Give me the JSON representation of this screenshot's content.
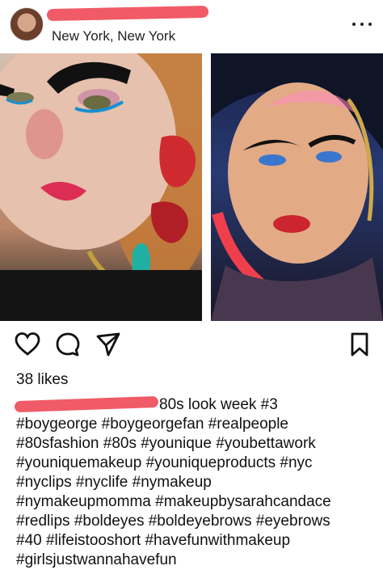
{
  "post": {
    "location": "New York, New York",
    "likes": "38 likes",
    "caption_lines": [
      "80s look week #3",
      "#boygeorge #boygeorgefan #realpeople",
      "#80sfashion #80s #younique #youbettawork",
      "#youniquemakeup #youniqueproducts #nyc",
      "#nyclips #nyclife #nymakeup",
      "#nymakeupmomma #makeupbysarahcandace",
      "#redlips #boldeyes #boldeyebrows #eyebrows",
      "#40 #lifeistooshort #havefunwithmakeup",
      "#girlsjustwannahavefun"
    ],
    "icons": {
      "more": "more-options-icon",
      "like": "heart-icon",
      "comment": "comment-icon",
      "share": "send-icon",
      "save": "bookmark-icon"
    }
  }
}
